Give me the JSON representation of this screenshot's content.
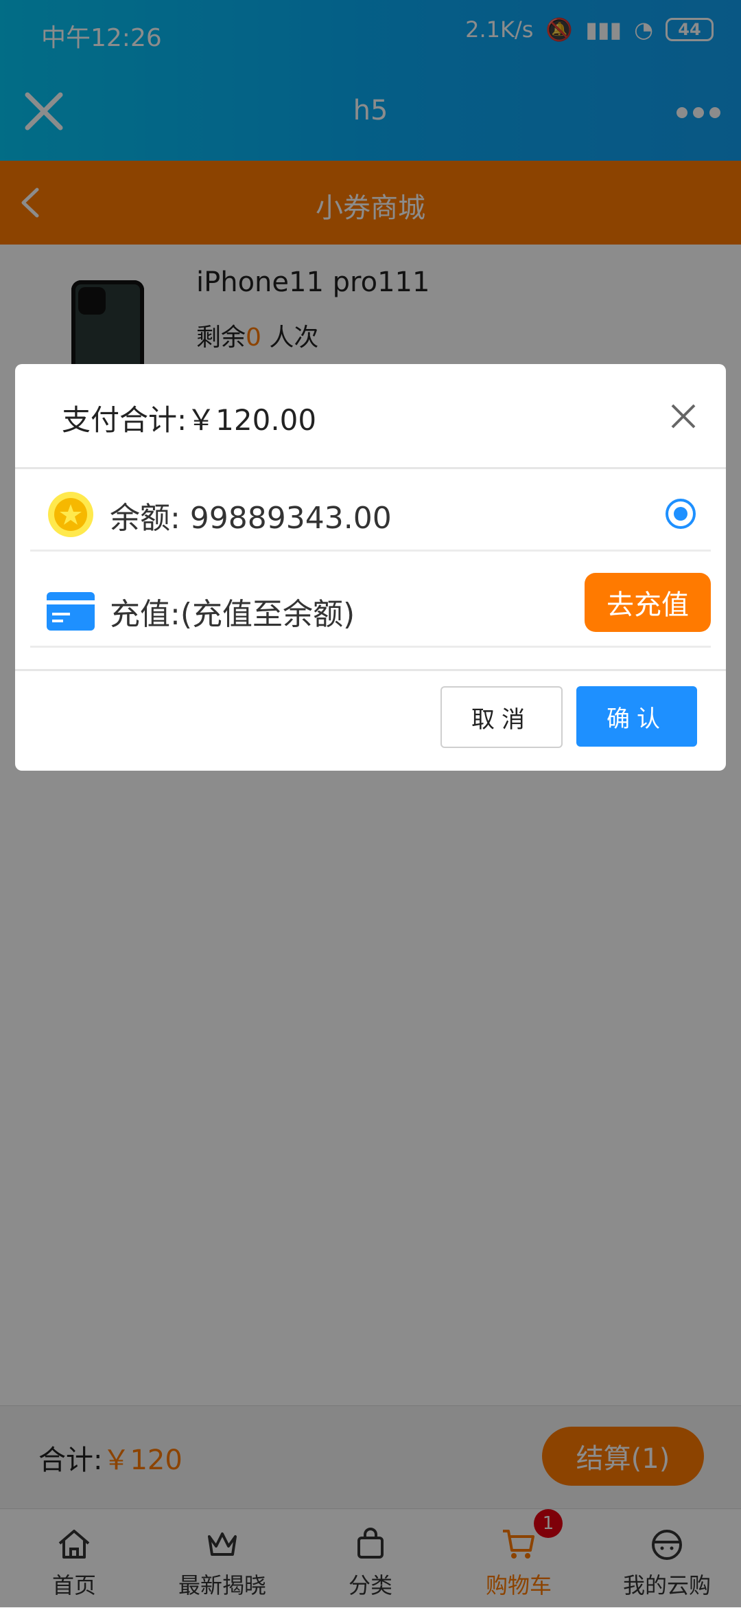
{
  "status_bar": {
    "time": "中午12:26",
    "network_speed": "2.1K/s",
    "battery": "44"
  },
  "app_bar": {
    "title": "h5"
  },
  "shop_header": {
    "title": "小券商城"
  },
  "product": {
    "name": "iPhone11 pro111",
    "remaining_prefix": "剩余",
    "remaining_count": "0",
    "remaining_suffix": " 人次"
  },
  "footer": {
    "total_label": "合计:",
    "total_value": "￥120",
    "checkout_label": "结算(1)"
  },
  "tabs": [
    {
      "label": "首页",
      "icon": "home-icon"
    },
    {
      "label": "最新揭晓",
      "icon": "crown-icon"
    },
    {
      "label": "分类",
      "icon": "bag-icon"
    },
    {
      "label": "购物车",
      "icon": "cart-icon",
      "badge": "1",
      "active": true
    },
    {
      "label": "我的云购",
      "icon": "user-cap-icon"
    }
  ],
  "modal": {
    "title": "支付合计:￥120.00",
    "balance_label": "余额: 99889343.00",
    "recharge_label": "充值:(充值至余额)",
    "recharge_button": "去充值",
    "cancel": "取消",
    "confirm": "确认"
  },
  "colors": {
    "brand_orange": "#ff7a00",
    "primary_blue": "#1e90ff",
    "top_gradient_start": "#05c6f5"
  }
}
